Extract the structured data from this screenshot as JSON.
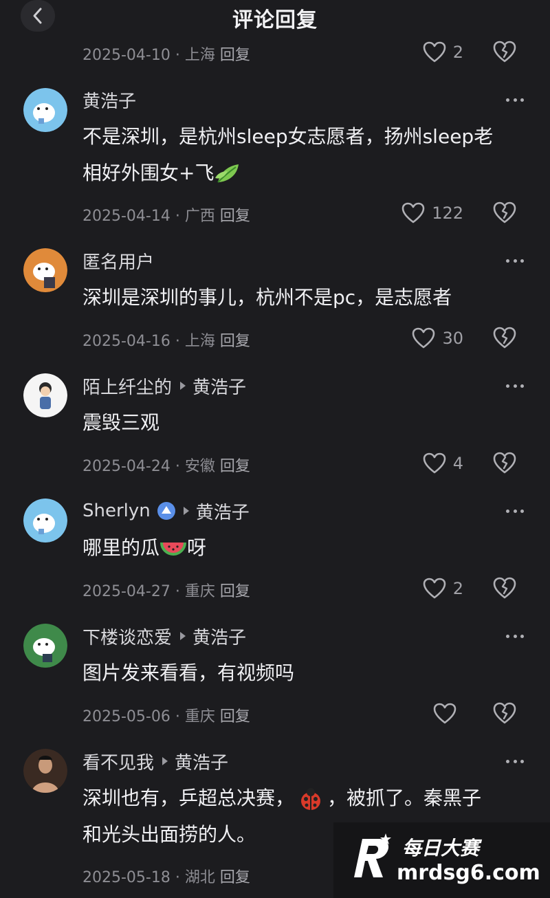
{
  "header": {
    "title": "评论回复"
  },
  "top_meta": {
    "date": "2025-04-10",
    "location": "上海",
    "reply": "回复",
    "likes": "2"
  },
  "comments": [
    {
      "name": "黄浩子",
      "reply_to": "",
      "content_lines": [
        "不是深圳，是杭州sleep女志愿者，扬州sleep老",
        "相好外围女+飞"
      ],
      "date": "2025-04-14",
      "location": "广西",
      "reply": "回复",
      "likes": "122"
    },
    {
      "name": "匿名用户",
      "reply_to": "",
      "content_lines": [
        "深圳是深圳的事儿，杭州不是pc，是志愿者"
      ],
      "date": "2025-04-16",
      "location": "上海",
      "reply": "回复",
      "likes": "30"
    },
    {
      "name": "陌上纤尘的",
      "reply_to": "黄浩子",
      "content_lines": [
        "震毁三观"
      ],
      "date": "2025-04-24",
      "location": "安徽",
      "reply": "回复",
      "likes": "4"
    },
    {
      "name": "Sherlyn",
      "reply_to": "黄浩子",
      "content_lines": [
        "哪里的瓜",
        "呀"
      ],
      "date": "2025-04-27",
      "location": "重庆",
      "reply": "回复",
      "likes": "2"
    },
    {
      "name": "下楼谈恋爱",
      "reply_to": "黄浩子",
      "content_lines": [
        "图片发来看看，有视频吗"
      ],
      "date": "2025-05-06",
      "location": "重庆",
      "reply": "回复",
      "likes": ""
    },
    {
      "name": "看不见我",
      "reply_to": "黄浩子",
      "content_lines": [
        "深圳也有，乒超总决赛，",
        "，被抓了。秦黑子",
        "和光头出面捞的人。"
      ],
      "date": "2025-05-18",
      "location": "湖北",
      "reply": "回复",
      "likes": ""
    }
  ],
  "watermark": {
    "line1": "每日大赛",
    "line2": "mrdsg6.com"
  },
  "colors": {
    "background": "#1c1c1f",
    "text": "#f0f0f3",
    "muted": "#8e8e94",
    "badge": "#5a8fe8"
  }
}
